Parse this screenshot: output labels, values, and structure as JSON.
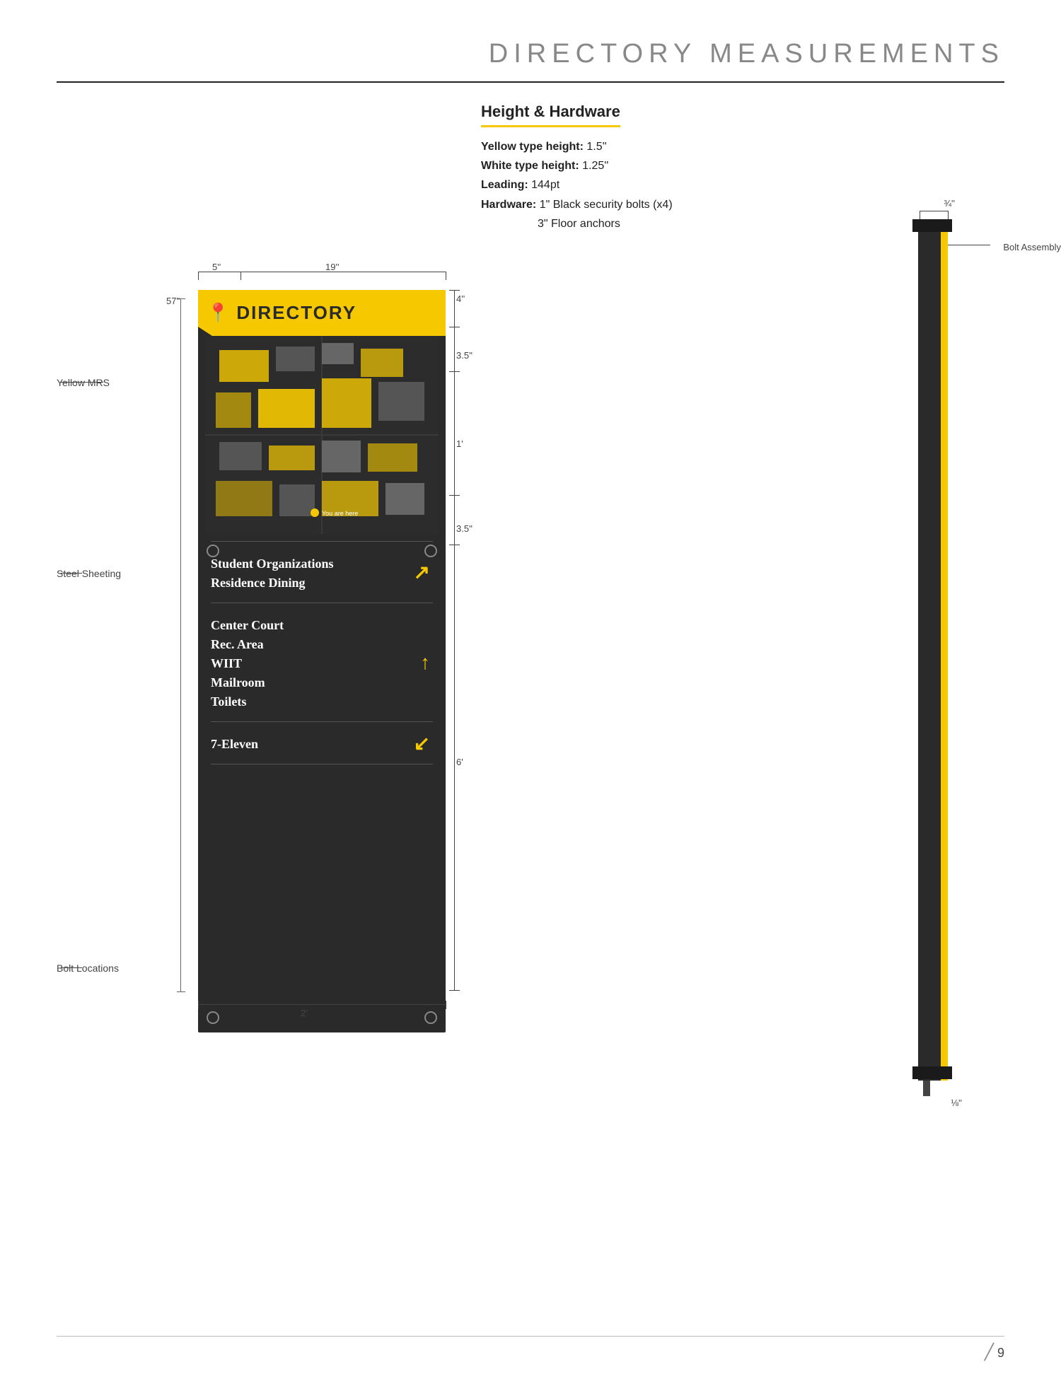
{
  "page": {
    "title": "DIRECTORY MEASUREMENTS",
    "number": "9"
  },
  "hardware": {
    "title": "Height & Hardware",
    "specs": [
      {
        "label": "Yellow type height:",
        "value": " 1.5''"
      },
      {
        "label": "White type height:",
        "value": " 1.25''"
      },
      {
        "label": "Leading:",
        "value": " 144pt"
      },
      {
        "label": "Hardware:",
        "value": " 1\" Black security bolts (x4)"
      },
      {
        "label": "",
        "value": "3\" Floor anchors"
      }
    ]
  },
  "sign": {
    "header_text": "DIRECTORY",
    "groups": [
      {
        "items": [
          "Student Organizations",
          "Residence Dining"
        ],
        "arrow": "↗"
      },
      {
        "items": [
          "Center Court",
          "Rec. Area",
          "WIIT",
          "Mailroom",
          "Toilets"
        ],
        "arrow": "↑"
      },
      {
        "items": [
          "7-Eleven"
        ],
        "arrow": "↙"
      }
    ]
  },
  "annotations": {
    "yellow_mrs": "Yellow MRS",
    "steel_sheeting": "Steel Sheeting",
    "bolt_locations": "Bolt Locations",
    "bolt_assembly": "Bolt Assembly",
    "dims": {
      "width_5": "5''",
      "width_19": "19''",
      "height_57": "57\"",
      "dim_4": "4''",
      "dim_3_5_top": "3.5''",
      "dim_1ft": "1'",
      "dim_3_5_bot": "3.5''",
      "dim_6ft": "6'",
      "dim_2ft": "2'",
      "dim_3_4": "¾''",
      "dim_1_8": "⅛''"
    }
  }
}
